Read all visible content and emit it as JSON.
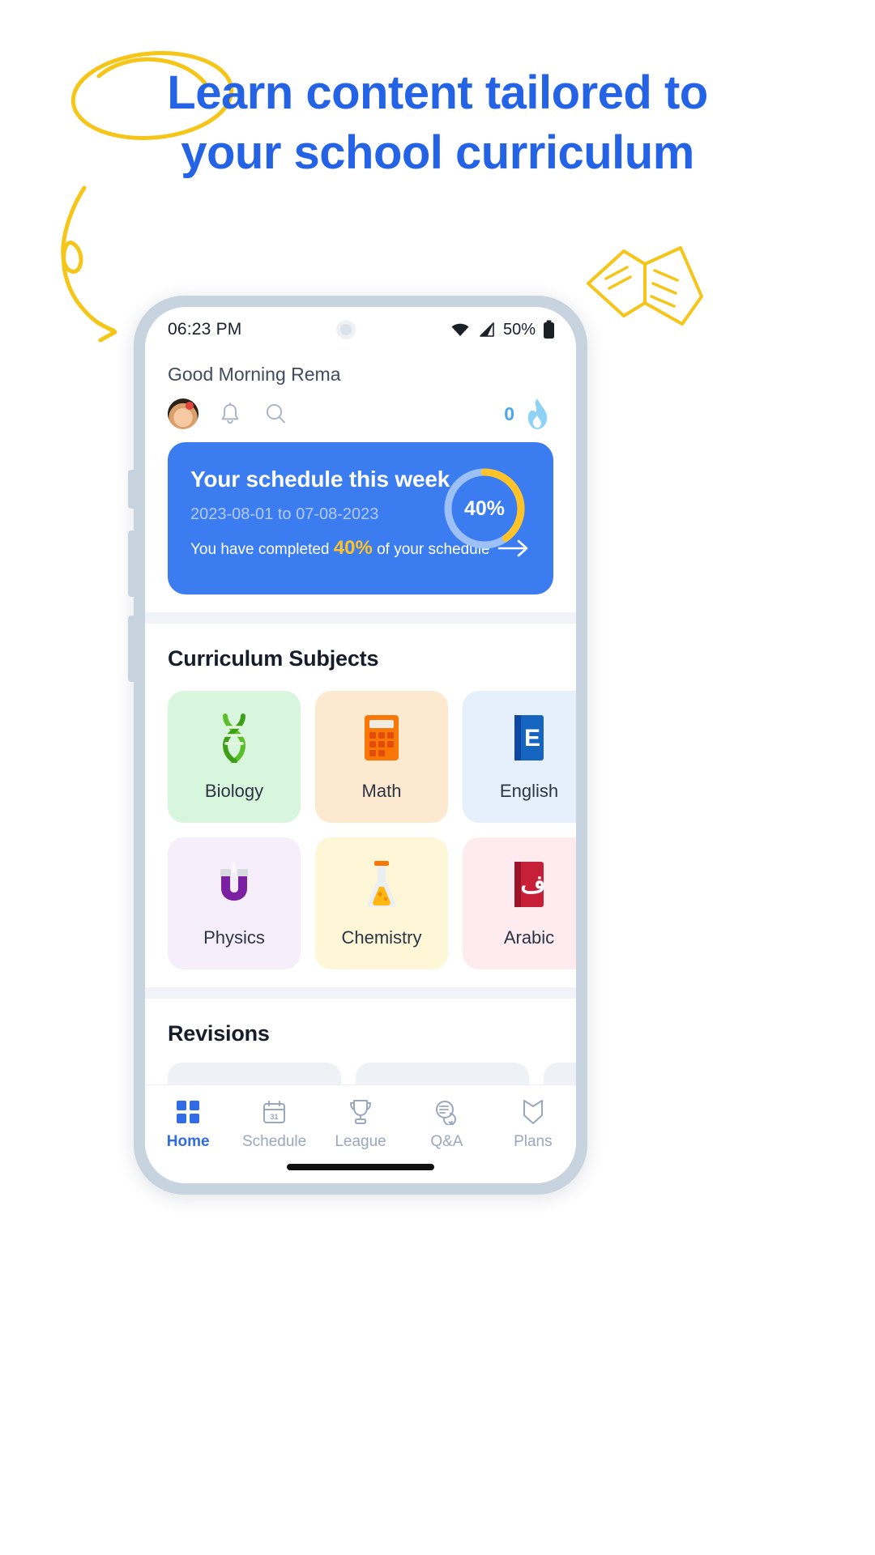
{
  "headline": {
    "line1": "Learn content tailored to",
    "line2": "your school curriculum",
    "accent_color": "#2563e6",
    "doodle_color": "#f5c518"
  },
  "phone": {
    "statusbar": {
      "time": "06:23 PM",
      "battery_percent": "50%",
      "icons": [
        "wifi-icon",
        "cellular-signal-icon",
        "battery-icon"
      ]
    },
    "header": {
      "greeting": "Good Morning Rema",
      "icons": [
        "avatar",
        "bell-icon",
        "search-icon"
      ],
      "streak_count": "0",
      "streak_icon": "flame-icon"
    },
    "schedule_card": {
      "title": "Your schedule this week",
      "date_range": "2023-08-01 to 07-08-2023",
      "note_prefix": "You have completed ",
      "note_value": "40%",
      "note_suffix": " of your schedule",
      "progress_label": "40%",
      "progress_percent": 40,
      "bg_color": "#3b7cf0",
      "accent_color": "#ffc227",
      "track_color": "#9dc0f7"
    },
    "subjects_section": {
      "title": "Curriculum Subjects",
      "items": [
        {
          "label": "Biology",
          "icon": "dna-icon",
          "bg": "#d8f5dd",
          "color": "#4caf27"
        },
        {
          "label": "Math",
          "icon": "calculator-icon",
          "bg": "#fde9cf",
          "color": "#f57c00"
        },
        {
          "label": "English",
          "icon": "book-e-icon",
          "bg": "#e6f0fd",
          "color": "#1565c0"
        },
        {
          "label": "Physics",
          "icon": "magnet-icon",
          "bg": "#f6eefb",
          "color": "#7b1fa2"
        },
        {
          "label": "Chemistry",
          "icon": "flask-icon",
          "bg": "#fdf7d8",
          "color": "#f9a825"
        },
        {
          "label": "Arabic",
          "icon": "book-a-icon",
          "bg": "#fdebef",
          "color": "#c62039"
        }
      ]
    },
    "revisions_section": {
      "title": "Revisions"
    },
    "bottom_nav": {
      "items": [
        {
          "label": "Home",
          "icon": "grid-icon",
          "active": true
        },
        {
          "label": "Schedule",
          "icon": "calendar-icon",
          "active": false
        },
        {
          "label": "League",
          "icon": "trophy-icon",
          "active": false
        },
        {
          "label": "Q&A",
          "icon": "chat-icon",
          "active": false
        },
        {
          "label": "Plans",
          "icon": "shield-icon",
          "active": false
        }
      ],
      "active_color": "#2f6ce5",
      "inactive_color": "#9aa7bd"
    }
  }
}
